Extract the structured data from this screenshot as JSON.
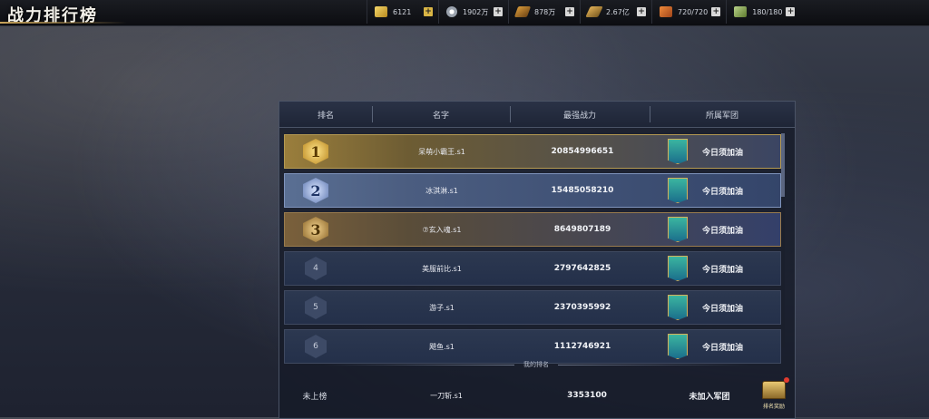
{
  "page": {
    "title": "战力排行榜"
  },
  "resources": [
    {
      "icon": "gold-ingot-icon",
      "value": "6121",
      "plus_style": "gold"
    },
    {
      "icon": "silver-coin-icon",
      "value": "1902万",
      "plus_style": "plain"
    },
    {
      "icon": "wood-icon",
      "value": "878万",
      "plus_style": "plain"
    },
    {
      "icon": "ore-icon",
      "value": "2.67亿",
      "plus_style": "plain"
    },
    {
      "icon": "food-icon",
      "value": "720/720",
      "plus_style": "plain"
    },
    {
      "icon": "banknote-icon",
      "value": "180/180",
      "plus_style": "plain"
    }
  ],
  "plus_symbol": "+",
  "table": {
    "headers": [
      "排名",
      "名字",
      "最强战力",
      "所属军团"
    ],
    "rows": [
      {
        "rank": "1",
        "name": "呆萌小霸王.s1",
        "power": "20854996651",
        "guild": "今日须加油"
      },
      {
        "rank": "2",
        "name": "冰淇淋.s1",
        "power": "15485058210",
        "guild": "今日须加油"
      },
      {
        "rank": "3",
        "name": "⑦玄入魂.s1",
        "power": "8649807189",
        "guild": "今日须加油"
      },
      {
        "rank": "4",
        "name": "美服前比.s1",
        "power": "2797642825",
        "guild": "今日须加油"
      },
      {
        "rank": "5",
        "name": "游子.s1",
        "power": "2370395992",
        "guild": "今日须加油"
      },
      {
        "rank": "6",
        "name": "飓鱼.s1",
        "power": "1112746921",
        "guild": "今日须加油"
      }
    ]
  },
  "my_rank_label": "我的排名",
  "my_rank": {
    "rank": "未上榜",
    "name": "一刀斩.s1",
    "power": "3353100",
    "guild": "未加入军团"
  },
  "reward_button": {
    "label": "排名奖励"
  }
}
